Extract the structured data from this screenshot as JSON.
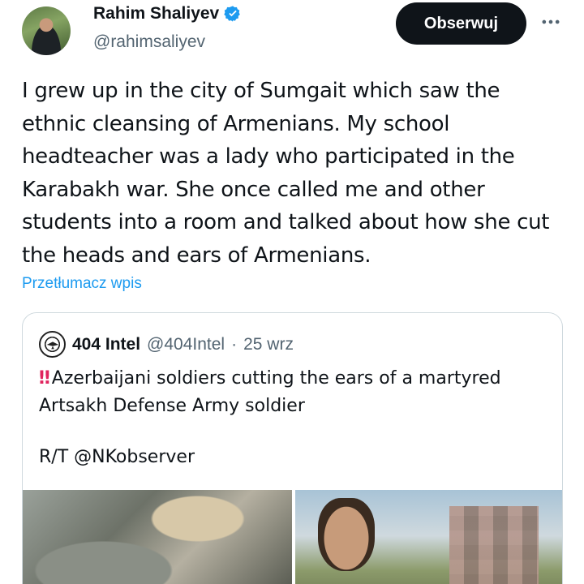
{
  "author": {
    "display_name": "Rahim Shaliyev",
    "handle": "@rahimsaliyev",
    "verified": true
  },
  "actions": {
    "follow_label": "Obserwuj",
    "more_icon": "more-horizontal-icon"
  },
  "tweet": {
    "text": "I grew up in the city of Sumgait which saw the ethnic cleansing of Armenians. My school headteacher was a lady who participated in the Karabakh war. She once called me and other students into a room and talked about how she cut the heads and ears of Armenians.",
    "translate_label": "Przetłumacz wpis"
  },
  "quote": {
    "display_name": "404 Intel",
    "handle": "@404Intel",
    "separator": "·",
    "date": "25 wrz",
    "alert_icon": "‼",
    "text_line1": "Azerbaijani soldiers cutting the ears of a martyred",
    "text_line2": "Artsakh Defense Army soldier",
    "credit": "R/T @NKobserver"
  },
  "colors": {
    "text": "#0f1419",
    "secondary": "#536471",
    "link": "#1d9bf0",
    "verified": "#1d9bf0",
    "border": "#cfd9de",
    "alert": "#e0245e"
  }
}
